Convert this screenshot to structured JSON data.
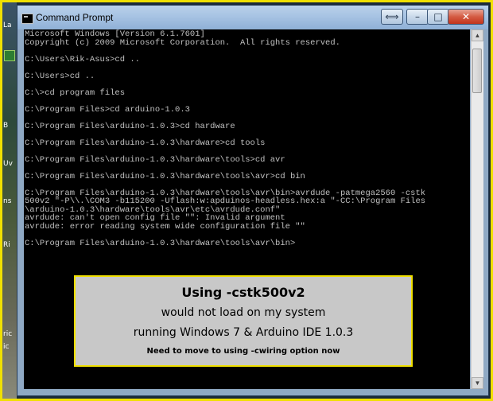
{
  "window": {
    "title": "Command Prompt",
    "buttons": {
      "extra": "⟺",
      "minimize": "–",
      "maximize": "□",
      "close": "✕"
    }
  },
  "desktop_strip": {
    "labels": [
      "La",
      "B",
      "Uv",
      "ns",
      "Ri",
      "ric",
      "ic"
    ]
  },
  "console": {
    "lines": [
      "Microsoft Windows [Version 6.1.7601]",
      "Copyright (c) 2009 Microsoft Corporation.  All rights reserved.",
      "",
      "C:\\Users\\Rik-Asus>cd ..",
      "",
      "C:\\Users>cd ..",
      "",
      "C:\\>cd program files",
      "",
      "C:\\Program Files>cd arduino-1.0.3",
      "",
      "C:\\Program Files\\arduino-1.0.3>cd hardware",
      "",
      "C:\\Program Files\\arduino-1.0.3\\hardware>cd tools",
      "",
      "C:\\Program Files\\arduino-1.0.3\\hardware\\tools>cd avr",
      "",
      "C:\\Program Files\\arduino-1.0.3\\hardware\\tools\\avr>cd bin",
      "",
      "C:\\Program Files\\arduino-1.0.3\\hardware\\tools\\avr\\bin>avrdude -patmega2560 -cstk",
      "500v2 \"-P\\\\.\\COM3 -b115200 -Uflash:w:apduinos-headless.hex:a \"-CC:\\Program Files",
      "\\arduino-1.0.3\\hardware\\tools\\avr\\etc\\avrdude.conf\"",
      "avrdude: can't open config file \"\": Invalid argument",
      "avrdude: error reading system wide configuration file \"\"",
      "",
      "C:\\Program Files\\arduino-1.0.3\\hardware\\tools\\avr\\bin>"
    ]
  },
  "caption": {
    "line1": "Using -cstk500v2",
    "line2": "would not load on my system",
    "line3": "running Windows 7 & Arduino IDE 1.0.3",
    "line4": "Need to move to using -cwiring option now"
  }
}
